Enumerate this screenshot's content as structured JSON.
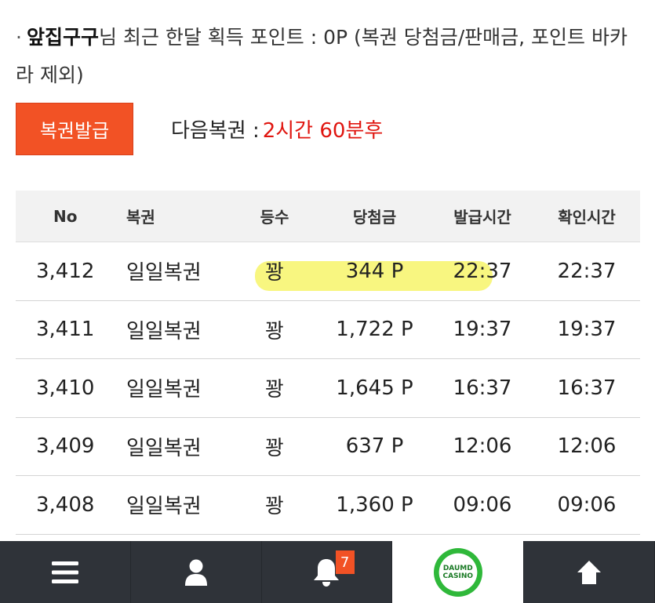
{
  "info": {
    "bullet": "·",
    "username": "앞집구구",
    "text": "님 최근 한달 획득 포인트 : 0P (복권 당첨금/판매금, 포인트 바카라 제외)"
  },
  "issue": {
    "button_label": "복권발급",
    "next_label": "다음복권 :",
    "next_value": "2시간 60분후"
  },
  "table": {
    "headers": [
      "No",
      "복권",
      "등수",
      "당첨금",
      "발급시간",
      "확인시간"
    ],
    "rows": [
      [
        "3,412",
        "일일복권",
        "꽝",
        "344 P",
        "22:37",
        "22:37"
      ],
      [
        "3,411",
        "일일복권",
        "꽝",
        "1,722 P",
        "19:37",
        "19:37"
      ],
      [
        "3,410",
        "일일복권",
        "꽝",
        "1,645 P",
        "16:37",
        "16:37"
      ],
      [
        "3,409",
        "일일복권",
        "꽝",
        "637 P",
        "12:06",
        "12:06"
      ],
      [
        "3,408",
        "일일복권",
        "꽝",
        "1,360 P",
        "09:06",
        "09:06"
      ]
    ]
  },
  "bottom_nav": {
    "notification_count": "7",
    "logo_text_top": "DAUMD",
    "logo_text_bottom": "CASINO",
    "icons": [
      "menu-icon",
      "user-icon",
      "bell-icon",
      "casino-logo",
      "arrow-up-icon"
    ]
  },
  "colors": {
    "accent": "#f25225",
    "countdown": "#e0150f",
    "nav_bg": "#2f3339",
    "highlight": "#f7f46a"
  }
}
